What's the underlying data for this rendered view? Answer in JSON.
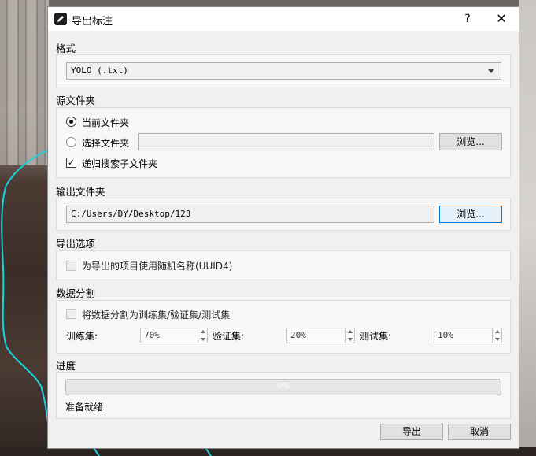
{
  "dialog": {
    "title": "导出标注",
    "help_label": "?",
    "close_label": "✕"
  },
  "format": {
    "section_label": "格式",
    "selected": "YOLO (.txt)"
  },
  "source": {
    "section_label": "源文件夹",
    "current_folder_label": "当前文件夹",
    "current_folder_selected": true,
    "choose_folder_label": "选择文件夹",
    "choose_folder_value": "",
    "browse_label": "浏览...",
    "recursive_label": "递归搜索子文件夹",
    "recursive_checked": true,
    "check_mark": "✓"
  },
  "output": {
    "section_label": "输出文件夹",
    "path": "C:/Users/DY/Desktop/123",
    "browse_label": "浏览..."
  },
  "options": {
    "section_label": "导出选项",
    "uuid_label": "为导出的项目使用随机名称(UUID4)",
    "uuid_checked": false
  },
  "split": {
    "section_label": "数据分割",
    "enable_label": "将数据分割为训练集/验证集/测试集",
    "enable_checked": false,
    "train_label": "训练集:",
    "train_value": "70%",
    "val_label": "验证集:",
    "val_value": "20%",
    "test_label": "测试集:",
    "test_value": "10%"
  },
  "progress": {
    "section_label": "进度",
    "value_text": "0%",
    "value": 0,
    "status": "准备就绪"
  },
  "footer": {
    "export_label": "导出",
    "cancel_label": "取消"
  },
  "colors": {
    "accent": "#0078d7",
    "outline": "#19d3e0"
  }
}
